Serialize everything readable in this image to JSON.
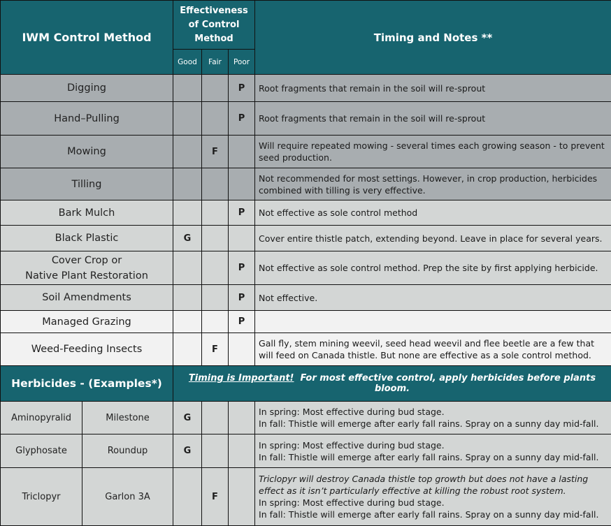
{
  "header": {
    "method_title": "IWM Control Method",
    "effectiveness_title": "Effectiveness of Control Method",
    "effectiveness_lines": [
      "Effectiveness",
      "of Control",
      "Method"
    ],
    "good_label": "Good",
    "fair_label": "Fair",
    "poor_label": "Poor",
    "notes_title": "Timing and Notes **"
  },
  "colors": {
    "header_teal": "#17646f",
    "row_dark_gray": "#a8adb0",
    "row_mid_gray": "#d3d6d5",
    "row_light_gray": "#f2f2f2"
  },
  "methods": [
    {
      "name_lines": [
        "Digging"
      ],
      "good": "",
      "fair": "",
      "poor": "P",
      "notes": "Root fragments that remain in the soil will re-sprout",
      "shade": "dark"
    },
    {
      "name_lines": [
        "Hand–Pulling"
      ],
      "good": "",
      "fair": "",
      "poor": "P",
      "notes": "Root fragments that remain in the soil will re-sprout",
      "shade": "dark"
    },
    {
      "name_lines": [
        "Mowing"
      ],
      "good": "",
      "fair": "F",
      "poor": "",
      "notes": "Will require repeated mowing - several times each growing season - to prevent seed production.",
      "shade": "dark"
    },
    {
      "name_lines": [
        "Tilling"
      ],
      "good": "",
      "fair": "",
      "poor": "",
      "notes": "Not recommended for most settings. However, in crop production, herbicides combined with tilling is very effective.",
      "shade": "dark"
    },
    {
      "name_lines": [
        "Bark Mulch"
      ],
      "good": "",
      "fair": "",
      "poor": "P",
      "notes": "Not effective as sole control method",
      "shade": "mid"
    },
    {
      "name_lines": [
        "Black Plastic"
      ],
      "good": "G",
      "fair": "",
      "poor": "",
      "notes": "Cover entire thistle patch, extending beyond. Leave in place for several years.",
      "shade": "mid"
    },
    {
      "name_lines": [
        "Cover Crop or",
        "Native Plant Restoration"
      ],
      "good": "",
      "fair": "",
      "poor": "P",
      "notes": "Not effective as sole control method. Prep the site by first applying herbicide.",
      "shade": "mid"
    },
    {
      "name_lines": [
        "Soil Amendments"
      ],
      "good": "",
      "fair": "",
      "poor": "P",
      "notes": "Not effective.",
      "shade": "mid"
    },
    {
      "name_lines": [
        "Managed Grazing"
      ],
      "good": "",
      "fair": "",
      "poor": "P",
      "notes": "",
      "shade": "light"
    },
    {
      "name_lines": [
        "Weed-Feeding Insects"
      ],
      "good": "",
      "fair": "F",
      "poor": "",
      "notes": "Gall fly, stem mining weevil, seed head weevil and flee beetle are a few that will feed on Canada thistle. But none are effective as a sole control method.",
      "shade": "light"
    }
  ],
  "herbicides_section": {
    "title": "Herbicides - (Examples*)",
    "banner_emphasis": "Timing is Important!",
    "banner_text": "For most effective control, apply herbicides before plants bloom."
  },
  "herbicides": [
    {
      "chemical": "Aminopyralid",
      "product": "Milestone",
      "good": "G",
      "fair": "",
      "poor": "",
      "notes_italic": "",
      "spring": "In spring:  Most effective during bud stage.",
      "fall": "In fall:  Thistle will emerge after early fall rains. Spray on a sunny day mid-fall."
    },
    {
      "chemical": "Glyphosate",
      "product": "Roundup",
      "good": "G",
      "fair": "",
      "poor": "",
      "notes_italic": "",
      "spring": "In spring:  Most effective during bud stage.",
      "fall": "In fall:  Thistle will emerge after early fall rains. Spray on a sunny day mid-fall."
    },
    {
      "chemical": "Triclopyr",
      "product": "Garlon 3A",
      "good": "",
      "fair": "F",
      "poor": "",
      "notes_italic": "Triclopyr will destroy Canada thistle top growth but does not have a lasting effect as it isn’t particularly effective at killing the robust root system.",
      "spring": "In spring:  Most effective during bud stage.",
      "fall": "In fall:  Thistle will emerge after early fall rains. Spray on a sunny day mid-fall."
    }
  ]
}
